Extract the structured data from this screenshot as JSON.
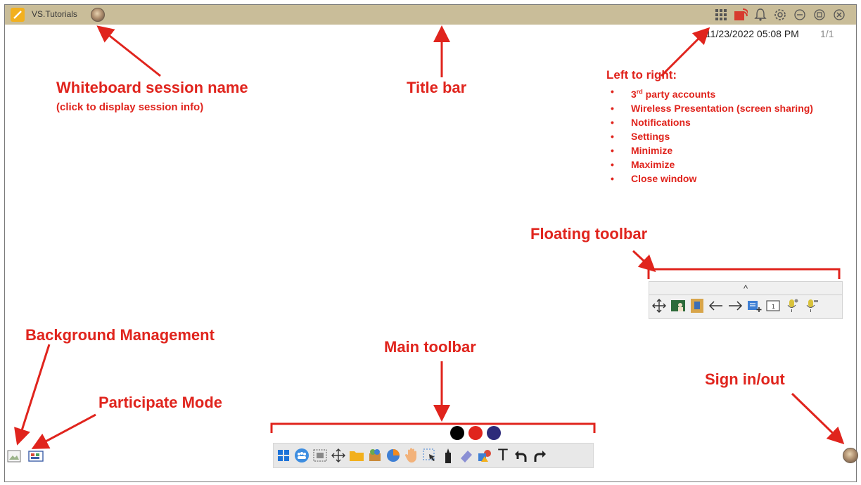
{
  "window": {
    "session_name": "VS.Tutorials",
    "datetime": "11/23/2022 05:08 PM",
    "page_count": "1/1"
  },
  "annotations": {
    "session_name_title": "Whiteboard session name",
    "session_name_sub": "(click to display session info)",
    "title_bar": "Title bar",
    "left_to_right": "Left to right:",
    "features": [
      "3rd party accounts",
      "Wireless Presentation (screen sharing)",
      "Notifications",
      "Settings",
      "Minimize",
      "Maximize",
      "Close window"
    ],
    "floating_toolbar": "Floating toolbar",
    "background_management": "Background Management",
    "participate_mode": "Participate Mode",
    "main_toolbar": "Main toolbar",
    "sign_in_out": "Sign in/out"
  },
  "floating_toolbar": {
    "expand_glyph": "^"
  },
  "main_toolbar": {
    "pen_colors": [
      "#000000",
      "#e0241d",
      "#2d2a7a"
    ],
    "text_tool": "T"
  },
  "colors": {
    "annotation": "#e0241d",
    "titlebar": "#c9bd99"
  }
}
